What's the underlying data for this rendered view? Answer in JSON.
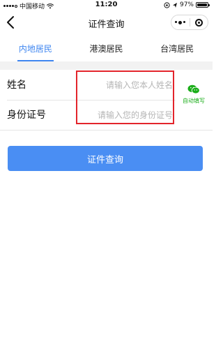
{
  "status_bar": {
    "carrier": "中国移动",
    "time": "11:20",
    "battery": "97%",
    "battery_level": 0.97
  },
  "nav": {
    "title": "证件查询"
  },
  "tabs": [
    {
      "label": "内地居民",
      "active": true
    },
    {
      "label": "港澳居民",
      "active": false
    },
    {
      "label": "台湾居民",
      "active": false
    }
  ],
  "form": {
    "name_label": "姓名",
    "name_placeholder": "请输入您本人姓名",
    "id_label": "身份证号",
    "id_placeholder": "请输入您的身份证号",
    "autofill_label": "自动填写"
  },
  "button": {
    "query_label": "证件查询"
  },
  "colors": {
    "accent": "#3f86f0",
    "button": "#4a8ef3",
    "wechat_green": "#1aad19",
    "highlight": "#e3242b"
  },
  "icons": {
    "back": "chevron-left-icon",
    "more": "more-dots-icon",
    "close": "target-circle-icon",
    "wechat": "wechat-icon",
    "wifi": "wifi-icon",
    "location": "location-icon",
    "battery": "battery-icon"
  }
}
